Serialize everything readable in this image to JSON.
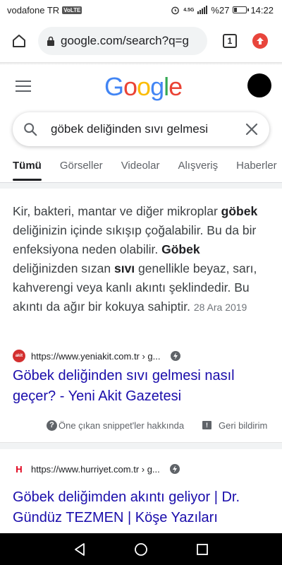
{
  "status_bar": {
    "carrier": "vodafone TR",
    "volte": "VoLTE",
    "network": "4.5G",
    "battery_percent": "%27",
    "battery_level": 0.27,
    "time": "14:22"
  },
  "browser": {
    "url": "google.com/search?q=g",
    "tab_count": "1"
  },
  "google": {
    "logo_letters": [
      {
        "ch": "G",
        "color": "#4285F4"
      },
      {
        "ch": "o",
        "color": "#EA4335"
      },
      {
        "ch": "o",
        "color": "#FBBC05"
      },
      {
        "ch": "g",
        "color": "#4285F4"
      },
      {
        "ch": "l",
        "color": "#34A853"
      },
      {
        "ch": "e",
        "color": "#EA4335"
      }
    ],
    "query": "göbek deliğinden sıvı gelmesi"
  },
  "tabs": [
    {
      "label": "Tümü",
      "active": true
    },
    {
      "label": "Görseller",
      "active": false
    },
    {
      "label": "Videolar",
      "active": false
    },
    {
      "label": "Alışveriş",
      "active": false
    },
    {
      "label": "Haberler",
      "active": false
    }
  ],
  "featured_snippet": {
    "segments": [
      {
        "text": "Kir, bakteri, mantar ve diğer mikroplar ",
        "bold": false
      },
      {
        "text": "göbek",
        "bold": true
      },
      {
        "text": " deliğinizin içinde sıkışıp çoğalabilir. Bu da bir enfeksiyona neden olabilir. ",
        "bold": false
      },
      {
        "text": "Göbek",
        "bold": true
      },
      {
        "text": " deliğinizden sızan ",
        "bold": false
      },
      {
        "text": "sıvı",
        "bold": true
      },
      {
        "text": " genellikle beyaz, sarı, kahverengi veya kanlı akıntı şeklindedir. Bu akıntı da ağır bir kokuya sahiptir.",
        "bold": false
      }
    ],
    "date": "28 Ara 2019",
    "source_url": "https://www.yeniakit.com.tr › g...",
    "source_favicon_text": "akit",
    "title": "Göbek deliğinden sıvı gelmesi nasıl geçer? - Yeni Akit Gazetesi",
    "about_label": "Öne çıkan snippet'ler hakkında",
    "feedback_label": "Geri bildirim"
  },
  "result2": {
    "favicon_text": "H",
    "source_url": "https://www.hurriyet.com.tr › g...",
    "title": "Göbek deliğimden akıntı geliyor | Dr. Gündüz TEZMEN | Köşe Yazıları"
  },
  "colors": {
    "link": "#1a0dab",
    "update_badge": "#e8453c"
  },
  "icons": [
    "home-icon",
    "lock-icon",
    "search-icon",
    "close-icon",
    "help-icon",
    "feedback-icon",
    "amp-icon",
    "back-icon",
    "home-circle-icon",
    "recents-icon"
  ]
}
